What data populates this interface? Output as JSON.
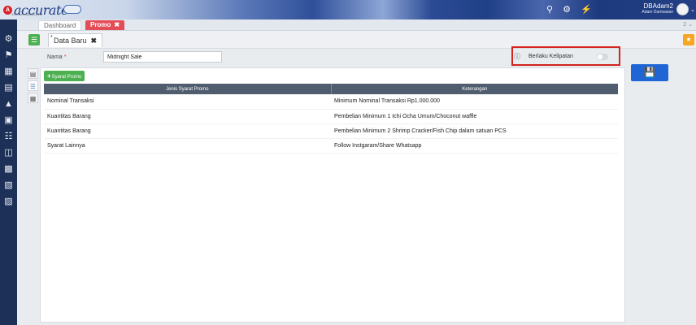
{
  "header": {
    "logo_text": "accurate",
    "logo_letter": "A",
    "version": "v1.0.0-rev#0804-210",
    "user_name": "DBAdam2",
    "user_sub": "Adam Darmawan"
  },
  "tabs": {
    "dashboard": "Dashboard",
    "promo": "Promo",
    "close": "✖",
    "more": "2 ⌄"
  },
  "subtab": {
    "label": "Data Baru",
    "close": "✖",
    "modified_mark": "*"
  },
  "form": {
    "name_label": "Nama",
    "required_mark": "*",
    "name_value": "Midnight Sale",
    "kelipatan_label": "Berlaku Kelipatan",
    "kelipatan_on": false
  },
  "buttons": {
    "add_label": "Syarat Promo"
  },
  "table": {
    "headers": [
      "Jenis Syarat Promo",
      "Keterangan"
    ],
    "rows": [
      [
        "Nominal Transaksi",
        "Minimum Nominal Transaksi Rp1.000.000"
      ],
      [
        "Kuantitas Barang",
        "Pembelian Minimum 1 Ichi Ocha Umum/Choconut waffle"
      ],
      [
        "Kuantitas Barang",
        "Pembelian Minimum 2 Shrimp Cracker/Fish Chip dalam satuan PCS"
      ],
      [
        "Syarat Lainnya",
        "Follow Instgaram/Share Whatsapp"
      ]
    ]
  },
  "colors": {
    "promo_tab": "#e44c57",
    "save_button": "#1f65d6",
    "highlight_box": "#d4231f",
    "add_button": "#4caf50"
  }
}
